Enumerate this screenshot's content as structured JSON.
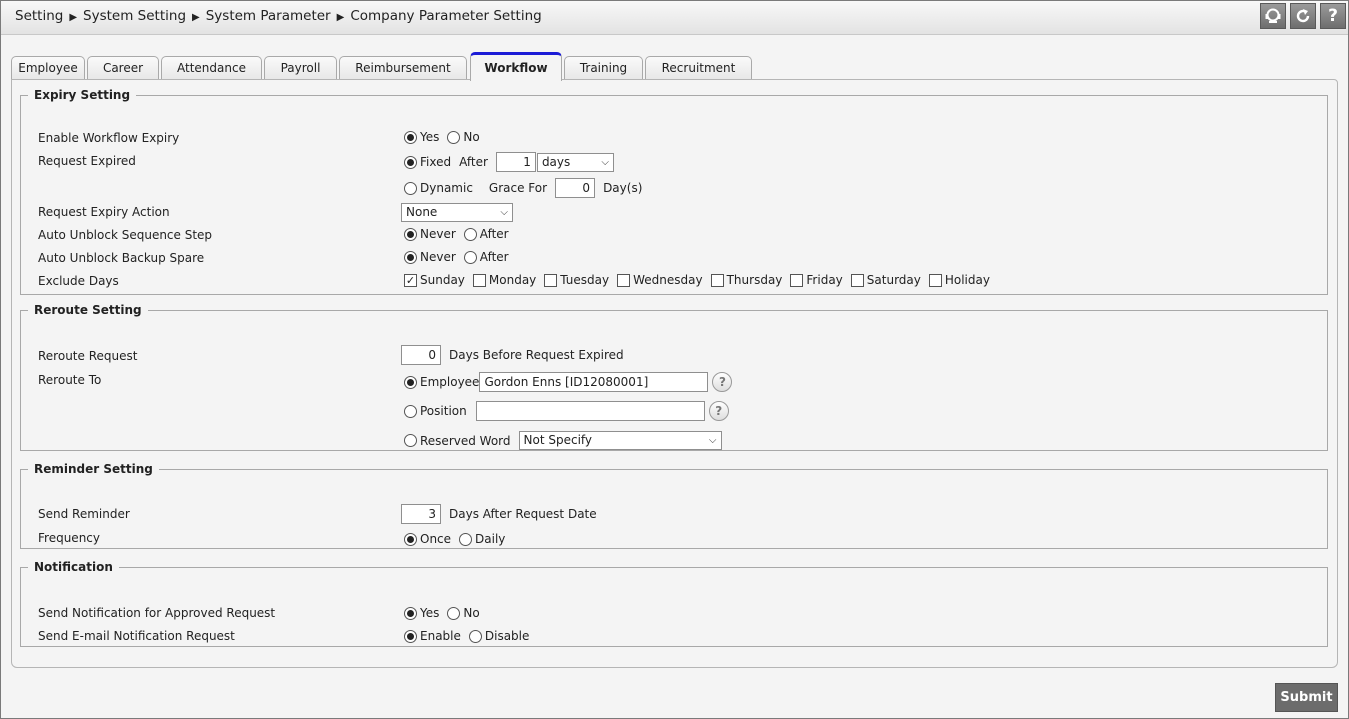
{
  "breadcrumb": [
    "Setting",
    "System Setting",
    "System Parameter",
    "Company Parameter Setting"
  ],
  "tabs": [
    {
      "label": "Employee",
      "active": false
    },
    {
      "label": "Career",
      "active": false
    },
    {
      "label": "Attendance",
      "active": false
    },
    {
      "label": "Payroll",
      "active": false
    },
    {
      "label": "Reimbursement",
      "active": false
    },
    {
      "label": "Workflow",
      "active": true
    },
    {
      "label": "Training",
      "active": false
    },
    {
      "label": "Recruitment",
      "active": false
    }
  ],
  "toolbar": {
    "help_glyph": "?"
  },
  "expiry": {
    "legend": "Expiry Setting",
    "enable_label": "Enable Workflow Expiry",
    "yes": "Yes",
    "no": "No",
    "request_expired_label": "Request Expired",
    "fixed": "Fixed",
    "after": "After",
    "after_value": "1",
    "unit": "days",
    "dynamic": "Dynamic",
    "grace_for": "Grace For",
    "grace_value": "0",
    "days_paren": "Day(s)",
    "action_label": "Request Expiry Action",
    "action_value": "None",
    "unblock_seq_label": "Auto Unblock Sequence Step",
    "unblock_backup_label": "Auto Unblock Backup Spare",
    "never": "Never",
    "after_opt": "After",
    "exclude_label": "Exclude Days",
    "days": [
      {
        "label": "Sunday",
        "checked": true
      },
      {
        "label": "Monday",
        "checked": false
      },
      {
        "label": "Tuesday",
        "checked": false
      },
      {
        "label": "Wednesday",
        "checked": false
      },
      {
        "label": "Thursday",
        "checked": false
      },
      {
        "label": "Friday",
        "checked": false
      },
      {
        "label": "Saturday",
        "checked": false
      },
      {
        "label": "Holiday",
        "checked": false
      }
    ]
  },
  "reroute": {
    "legend": "Reroute Setting",
    "request_label": "Reroute Request",
    "request_value": "0",
    "request_suffix": "Days Before Request Expired",
    "to_label": "Reroute To",
    "employee": "Employee",
    "employee_value": "Gordon Enns [ID12080001]",
    "position": "Position",
    "position_value": "",
    "reserved": "Reserved Word",
    "reserved_value": "Not Specify"
  },
  "reminder": {
    "legend": "Reminder Setting",
    "send_label": "Send Reminder",
    "send_value": "3",
    "send_suffix": "Days After Request Date",
    "freq_label": "Frequency",
    "once": "Once",
    "daily": "Daily"
  },
  "notification": {
    "legend": "Notification",
    "approved_label": "Send Notification for Approved Request",
    "yes": "Yes",
    "no": "No",
    "email_label": "Send E-mail Notification Request",
    "enable": "Enable",
    "disable": "Disable"
  },
  "submit_label": "Submit"
}
